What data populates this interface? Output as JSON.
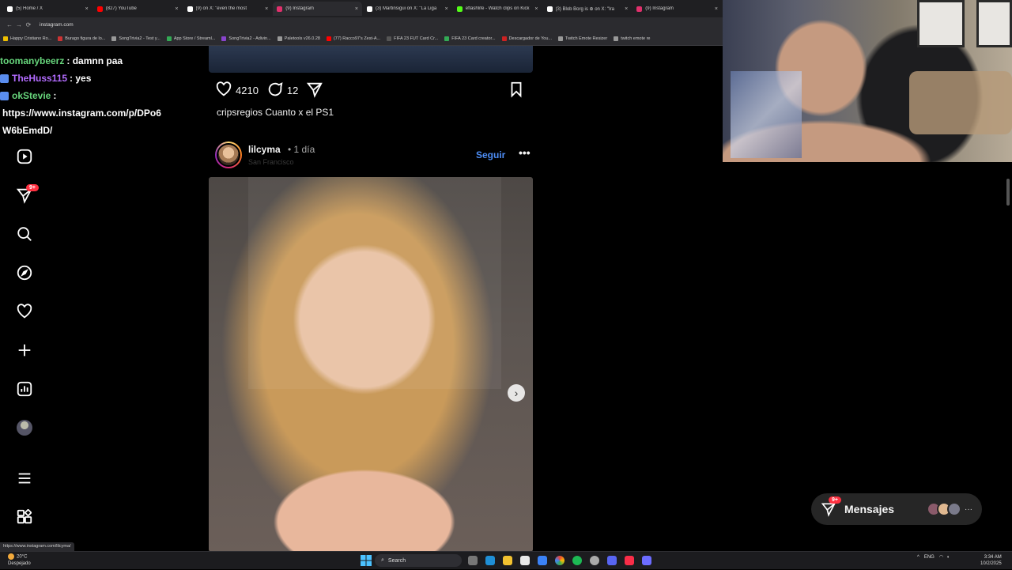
{
  "browser": {
    "tabs": [
      {
        "title": "(5) Home / X",
        "icon": "x-logo-icon",
        "color": "#ffffff"
      },
      {
        "title": "(827) YouTube",
        "icon": "youtube-icon",
        "color": "#ff0000"
      },
      {
        "title": "(9) on X: \"even the most",
        "icon": "x-logo-icon",
        "color": "#ffffff"
      },
      {
        "title": "(9) Instagram",
        "icon": "instagram-icon",
        "color": "#e1306c",
        "active": true
      },
      {
        "title": "(3) Martinsigui on X: \"La Liga",
        "icon": "x-logo-icon",
        "color": "#ffffff"
      },
      {
        "title": "eflashlife - Watch clips on Kick",
        "icon": "kick-icon",
        "color": "#53fc18"
      },
      {
        "title": "(3) Blob Borg is ⊕ on X: \"Ira",
        "icon": "x-logo-icon",
        "color": "#ffffff"
      },
      {
        "title": "(9) Instagram",
        "icon": "instagram-icon",
        "color": "#e1306c"
      }
    ],
    "url": "instagram.com",
    "bookmarks": [
      {
        "label": "Happy Cristiano Ro...",
        "color": "#f0c000"
      },
      {
        "label": "Burago figura de lo...",
        "color": "#cc3333"
      },
      {
        "label": "SongTrivia2 - Test y...",
        "color": "#999999"
      },
      {
        "label": "App Store / Streaml...",
        "color": "#33aa55"
      },
      {
        "label": "SongTrivia2 - Adivin...",
        "color": "#8844cc"
      },
      {
        "label": "Paletools v26.0.28",
        "color": "#999999"
      },
      {
        "label": "(77) Racco97's Zest-A...",
        "color": "#ff0000"
      },
      {
        "label": "FIFA 23 FUT Card Cr...",
        "color": "#555555"
      },
      {
        "label": "FIFA 23 Card creator...",
        "color": "#33aa55"
      },
      {
        "label": "Descargador de You...",
        "color": "#cc2222"
      },
      {
        "label": "Twitch Emote Resizer",
        "color": "#999999"
      },
      {
        "label": "twitch emote re",
        "color": "#999999"
      }
    ]
  },
  "chat": [
    {
      "user": "toomanybeerz",
      "user_color": "#67d67c",
      "message": ": damnn paa",
      "badge_color": ""
    },
    {
      "user": "TheHuss115",
      "user_color": "#b36cff",
      "message": ": yes",
      "badge_color": "#5a8dee"
    },
    {
      "user": "okStevie",
      "user_color": "#67d67c",
      "message": ":",
      "badge_color": "#5a8dee"
    },
    {
      "user": "",
      "user_color": "#ffffff",
      "message": "https://www.instagram.com/p/DPo6",
      "badge_color": ""
    },
    {
      "user": "",
      "user_color": "#ffffff",
      "message": "W6bEmdD/",
      "badge_color": ""
    }
  ],
  "instagram_nav": {
    "items": [
      "reels-icon",
      "messages-icon",
      "search-icon",
      "explore-icon",
      "notifications-icon",
      "create-icon",
      "dashboard-icon",
      "profile-icon",
      "more-menu-icon",
      "also-from-meta-icon"
    ],
    "messages_badge": "9+"
  },
  "prev_post": {
    "likes": "4210",
    "comments": "12",
    "caption_user": "cripsregios",
    "caption_text": "Cuanto x el PS1"
  },
  "post": {
    "username": "lilcyma",
    "separator": "•",
    "age": "1 día",
    "location": "San Francisco",
    "follow_label": "Seguir",
    "more_label": "•••",
    "next_label": "›"
  },
  "messages_pill": {
    "label": "Mensajes",
    "badge": "9+",
    "more": "···"
  },
  "status_url": "https://www.instagram.com/lilcyma/",
  "taskbar": {
    "weather_temp": "20°C",
    "weather_desc": "Despejado",
    "search_label": "Search",
    "lang": "ENG",
    "time": "3:34 AM",
    "date": "10/2/2025"
  },
  "colors": {
    "accent": "#4d8df5",
    "badge": "#ff3040"
  }
}
